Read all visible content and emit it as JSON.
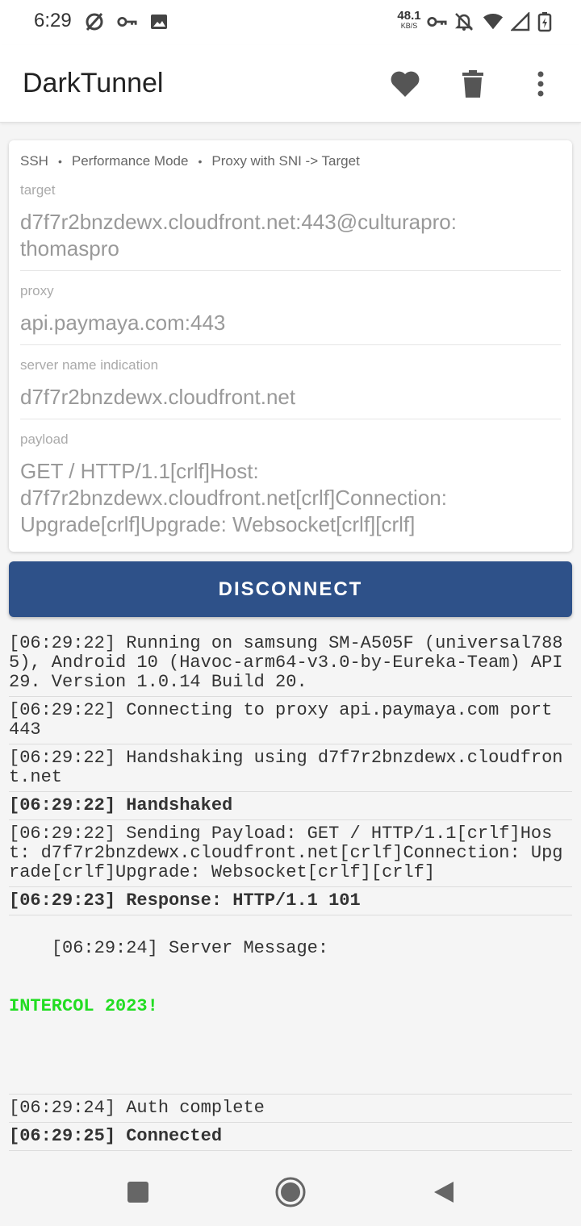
{
  "status_bar": {
    "time": "6:29",
    "speed_value": "48.1",
    "speed_unit": "KB/S"
  },
  "app_bar": {
    "title": "DarkTunnel",
    "icons": [
      "heart-icon",
      "trash-icon",
      "more-vert-icon"
    ]
  },
  "config": {
    "modes": [
      "SSH",
      "Performance Mode",
      "Proxy with SNI -> Target"
    ],
    "separator": "•",
    "target_label": "target",
    "target_value": "d7f7r2bnzdewx.cloudfront.net:443@culturapro:\nthomaspro",
    "proxy_label": "proxy",
    "proxy_value": "api.paymaya.com:443",
    "sni_label": "server name indication",
    "sni_value": "d7f7r2bnzdewx.cloudfront.net",
    "payload_label": "payload",
    "payload_value": "GET / HTTP/1.1[crlf]Host:\nd7f7r2bnzdewx.cloudfront.net[crlf]Connection:\nUpgrade[crlf]Upgrade: Websocket[crlf][crlf]"
  },
  "button": {
    "label": "DISCONNECT",
    "color": "#2e5189"
  },
  "log": [
    {
      "text": "[06:29:22] Running on samsung SM-A505F (universal7885), Android 10 (Havoc-arm64-v3.0-by-Eureka-Team) API 29. Version 1.0.14 Build 20.",
      "bold": false
    },
    {
      "text": "[06:29:22] Connecting to proxy api.paymaya.com port 443",
      "bold": false
    },
    {
      "text": "[06:29:22] Handshaking using d7f7r2bnzdewx.cloudfront.net",
      "bold": false
    },
    {
      "text": "[06:29:22] Handshaked",
      "bold": true
    },
    {
      "text": "[06:29:22] Sending Payload: GET / HTTP/1.1[crlf]Host: d7f7r2bnzdewx.cloudfront.net[crlf]Connection: Upgrade[crlf]Upgrade: Websocket[crlf][crlf]",
      "bold": false
    },
    {
      "text": "[06:29:23] Response: HTTP/1.1 101",
      "bold": true
    },
    {
      "text": "[06:29:24] Server Message:",
      "bold": false,
      "message": "INTERCOL 2023!",
      "message_color": "#22dd22"
    },
    {
      "text": "[06:29:24] Auth complete",
      "bold": false
    },
    {
      "text": "[06:29:25] Connected",
      "bold": true
    }
  ],
  "nav_bar": {
    "icons": [
      "recents-square-icon",
      "home-circle-icon",
      "back-triangle-icon"
    ]
  }
}
